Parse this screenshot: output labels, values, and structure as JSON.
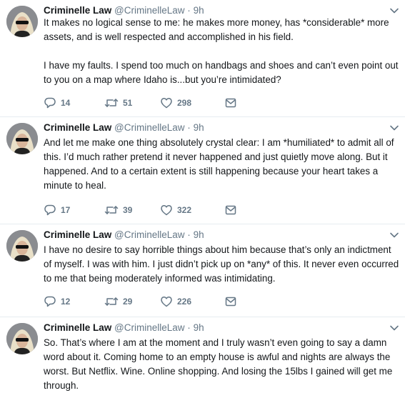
{
  "account": {
    "name": "Criminelle Law",
    "handle": "@CriminelleLaw"
  },
  "separator": "·",
  "tweets": [
    {
      "time": "9h",
      "paragraphs": [
        "It makes no logical sense to me: he makes more money, has *considerable* more assets, and is well respected and accomplished in his field.",
        "I have my faults. I spend too much on handbags and shoes and can’t even point out to you on a map where Idaho is...but you’re intimidated?"
      ],
      "replies": "14",
      "retweets": "51",
      "likes": "298"
    },
    {
      "time": "9h",
      "paragraphs": [
        "And let me make one thing absolutely crystal clear: I am *humiliated* to admit all of this. I’d much rather pretend it never happened and just quietly move along. But it happened. And to a certain extent is still happening because your heart takes a minute to heal."
      ],
      "replies": "17",
      "retweets": "39",
      "likes": "322"
    },
    {
      "time": "9h",
      "paragraphs": [
        "I have no desire to say horrible things about him because that’s only an indictment of myself. I was with him. I just didn’t pick up on *any* of this. It never even occurred to me that being moderately informed was intimidating."
      ],
      "replies": "12",
      "retweets": "29",
      "likes": "226"
    },
    {
      "time": "9h",
      "paragraphs": [
        "So. That’s where I am at the moment and I truly wasn’t even going to say a damn word about it. Coming home to an empty house is awful and nights are always the worst. But Netflix. Wine. Online shopping. And losing the 15lbs I gained will get me through."
      ]
    }
  ],
  "icons": {
    "reply": "reply-icon",
    "retweet": "retweet-icon",
    "like": "heart-icon",
    "dm": "envelope-icon",
    "menu": "chevron-down-icon",
    "avatar": "profile-photo"
  },
  "colors": {
    "text": "#14171a",
    "muted": "#657786",
    "divider": "#e6ecf0"
  }
}
